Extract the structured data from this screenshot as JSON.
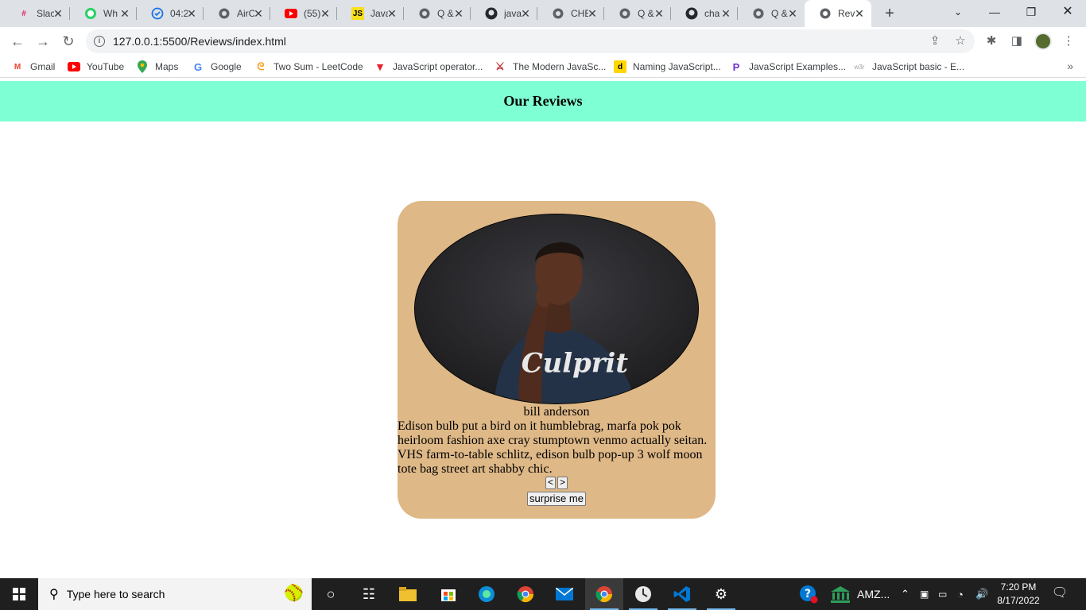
{
  "browser": {
    "tabs": [
      {
        "title": "Slac",
        "icon": "slack-icon",
        "color": "#e01e5a"
      },
      {
        "title": "Wh",
        "icon": "whatsapp-icon",
        "color": "#25d366"
      },
      {
        "title": "04:2",
        "icon": "check-circle-icon",
        "color": "#1a73e8"
      },
      {
        "title": "AirC",
        "icon": "globe-icon",
        "color": "#5f6368"
      },
      {
        "title": "(55)",
        "icon": "youtube-icon",
        "color": "#ff0000"
      },
      {
        "title": "Java",
        "icon": "js-icon",
        "color": "#f7df1e"
      },
      {
        "title": "Q &",
        "icon": "globe-icon",
        "color": "#5f6368"
      },
      {
        "title": "java",
        "icon": "github-icon",
        "color": "#24292e"
      },
      {
        "title": "CHE",
        "icon": "globe-icon",
        "color": "#5f6368"
      },
      {
        "title": "Q &",
        "icon": "globe-icon",
        "color": "#5f6368"
      },
      {
        "title": "cha",
        "icon": "github-icon",
        "color": "#24292e"
      },
      {
        "title": "Q &",
        "icon": "globe-icon",
        "color": "#5f6368"
      },
      {
        "title": "Rev",
        "icon": "globe-icon",
        "color": "#5f6368",
        "active": true
      }
    ],
    "url": "127.0.0.1:5500/Reviews/index.html",
    "bookmarks": [
      {
        "label": "Gmail",
        "icon": "gmail-icon"
      },
      {
        "label": "YouTube",
        "icon": "youtube-icon"
      },
      {
        "label": "Maps",
        "icon": "maps-icon"
      },
      {
        "label": "Google",
        "icon": "google-icon"
      },
      {
        "label": "Two Sum - LeetCode",
        "icon": "leetcode-icon"
      },
      {
        "label": "JavaScript operator...",
        "icon": "triangle-icon"
      },
      {
        "label": "The Modern JavaSc...",
        "icon": "runner-icon"
      },
      {
        "label": "Naming JavaScript...",
        "icon": "dev-icon"
      },
      {
        "label": "JavaScript Examples...",
        "icon": "programiz-icon"
      },
      {
        "label": "JavaScript basic - E...",
        "icon": "w3r-icon"
      }
    ]
  },
  "page": {
    "header_title": "Our Reviews",
    "review": {
      "name": "bill anderson",
      "text": "Edison bulb put a bird on it humblebrag, marfa pok pok heirloom fashion axe cray stumptown venmo actually seitan. VHS farm-to-table schlitz, edison bulb pop-up 3 wolf moon tote bag street art shabby chic.",
      "shirt_text": "Culprit"
    },
    "prev_label": "<",
    "next_label": ">",
    "surprise_label": "surprise me"
  },
  "taskbar": {
    "search_placeholder": "Type here to search",
    "tray_app_label": "AMZ...",
    "time": "7:20 PM",
    "date": "8/17/2022"
  },
  "colors": {
    "header_bg": "#7fffd4",
    "card_bg": "#deb887"
  }
}
